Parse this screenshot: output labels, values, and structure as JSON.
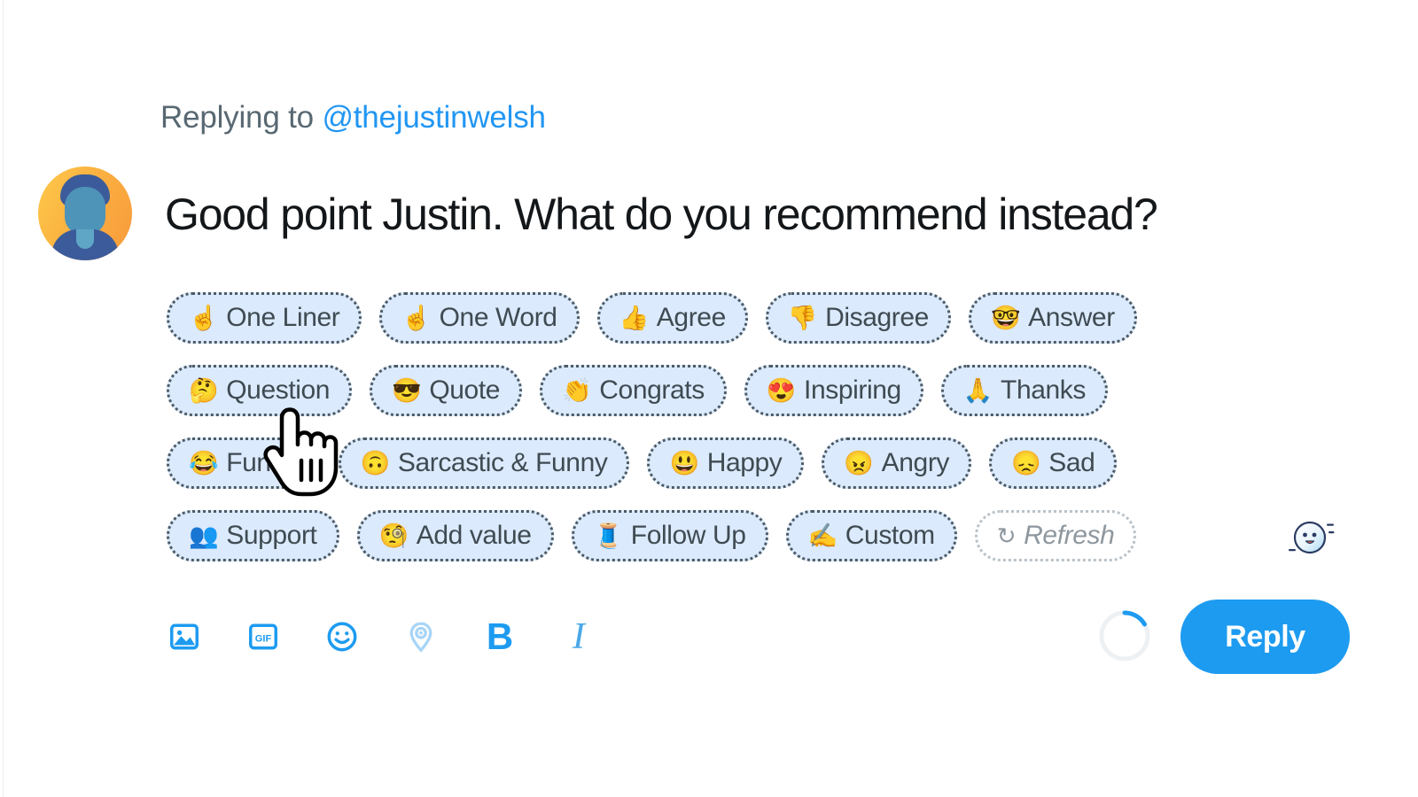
{
  "reply_context": {
    "prefix": "Replying to ",
    "handle": "@thejustinwelsh"
  },
  "composer": {
    "avatar_name": "user-avatar",
    "reply_text": "Good point Justin. What do you recommend instead?"
  },
  "chip_rows": [
    [
      {
        "emoji": "☝️",
        "label": "One Liner",
        "name": "chip-one-liner",
        "style": "filled"
      },
      {
        "emoji": "☝️",
        "label": "One Word",
        "name": "chip-one-word",
        "style": "filled"
      },
      {
        "emoji": "👍",
        "label": "Agree",
        "name": "chip-agree",
        "style": "filled"
      },
      {
        "emoji": "👎",
        "label": "Disagree",
        "name": "chip-disagree",
        "style": "filled"
      },
      {
        "emoji": "🤓",
        "label": "Answer",
        "name": "chip-answer",
        "style": "filled"
      }
    ],
    [
      {
        "emoji": "🤔",
        "label": "Question",
        "name": "chip-question",
        "style": "filled"
      },
      {
        "emoji": "😎",
        "label": "Quote",
        "name": "chip-quote",
        "style": "filled"
      },
      {
        "emoji": "👏",
        "label": "Congrats",
        "name": "chip-congrats",
        "style": "filled"
      },
      {
        "emoji": "😍",
        "label": "Inspiring",
        "name": "chip-inspiring",
        "style": "filled"
      },
      {
        "emoji": "🙏",
        "label": "Thanks",
        "name": "chip-thanks",
        "style": "filled"
      }
    ],
    [
      {
        "emoji": "😂",
        "label": "Funny",
        "name": "chip-funny",
        "style": "filled"
      },
      {
        "emoji": "🙃",
        "label": "Sarcastic & Funny",
        "name": "chip-sarcastic-and-funny",
        "style": "filled"
      },
      {
        "emoji": "😃",
        "label": "Happy",
        "name": "chip-happy",
        "style": "filled"
      },
      {
        "emoji": "😠",
        "label": "Angry",
        "name": "chip-angry",
        "style": "filled"
      },
      {
        "emoji": "😞",
        "label": "Sad",
        "name": "chip-sad",
        "style": "filled"
      }
    ],
    [
      {
        "emoji": "👥",
        "label": "Support",
        "name": "chip-support",
        "style": "filled"
      },
      {
        "emoji": "🧐",
        "label": "Add value",
        "name": "chip-add-value",
        "style": "filled"
      },
      {
        "emoji": "🧵",
        "label": "Follow Up",
        "name": "chip-follow-up",
        "style": "filled"
      },
      {
        "emoji": "✍️",
        "label": "Custom",
        "name": "chip-custom",
        "style": "filled"
      },
      {
        "emoji": "↻",
        "label": "Refresh",
        "name": "chip-refresh",
        "style": "ghost"
      }
    ]
  ],
  "toolbar": {
    "items": [
      {
        "icon": "image-icon",
        "label": "Image"
      },
      {
        "icon": "gif-icon",
        "label": "GIF"
      },
      {
        "icon": "emoji-icon",
        "label": "Emoji"
      },
      {
        "icon": "location-pin-icon",
        "label": "Location"
      },
      {
        "icon": "bold-icon",
        "label": "B"
      },
      {
        "icon": "italic-icon",
        "label": "I"
      }
    ],
    "gif_label": "GIF",
    "bold_label": "B",
    "italic_label": "I",
    "reply_button_label": "Reply"
  },
  "assistant": {
    "bot_icon_name": "ai-assistant-bot-icon"
  },
  "cursor": {
    "type": "pointing-hand-cursor"
  },
  "colors": {
    "accent_blue": "#1d9bf0",
    "handle_blue": "#2196f3",
    "chip_fill": "#dbeafc",
    "chip_border": "#4d5b66",
    "text_dark": "#14171a",
    "text_muted": "#586872"
  }
}
